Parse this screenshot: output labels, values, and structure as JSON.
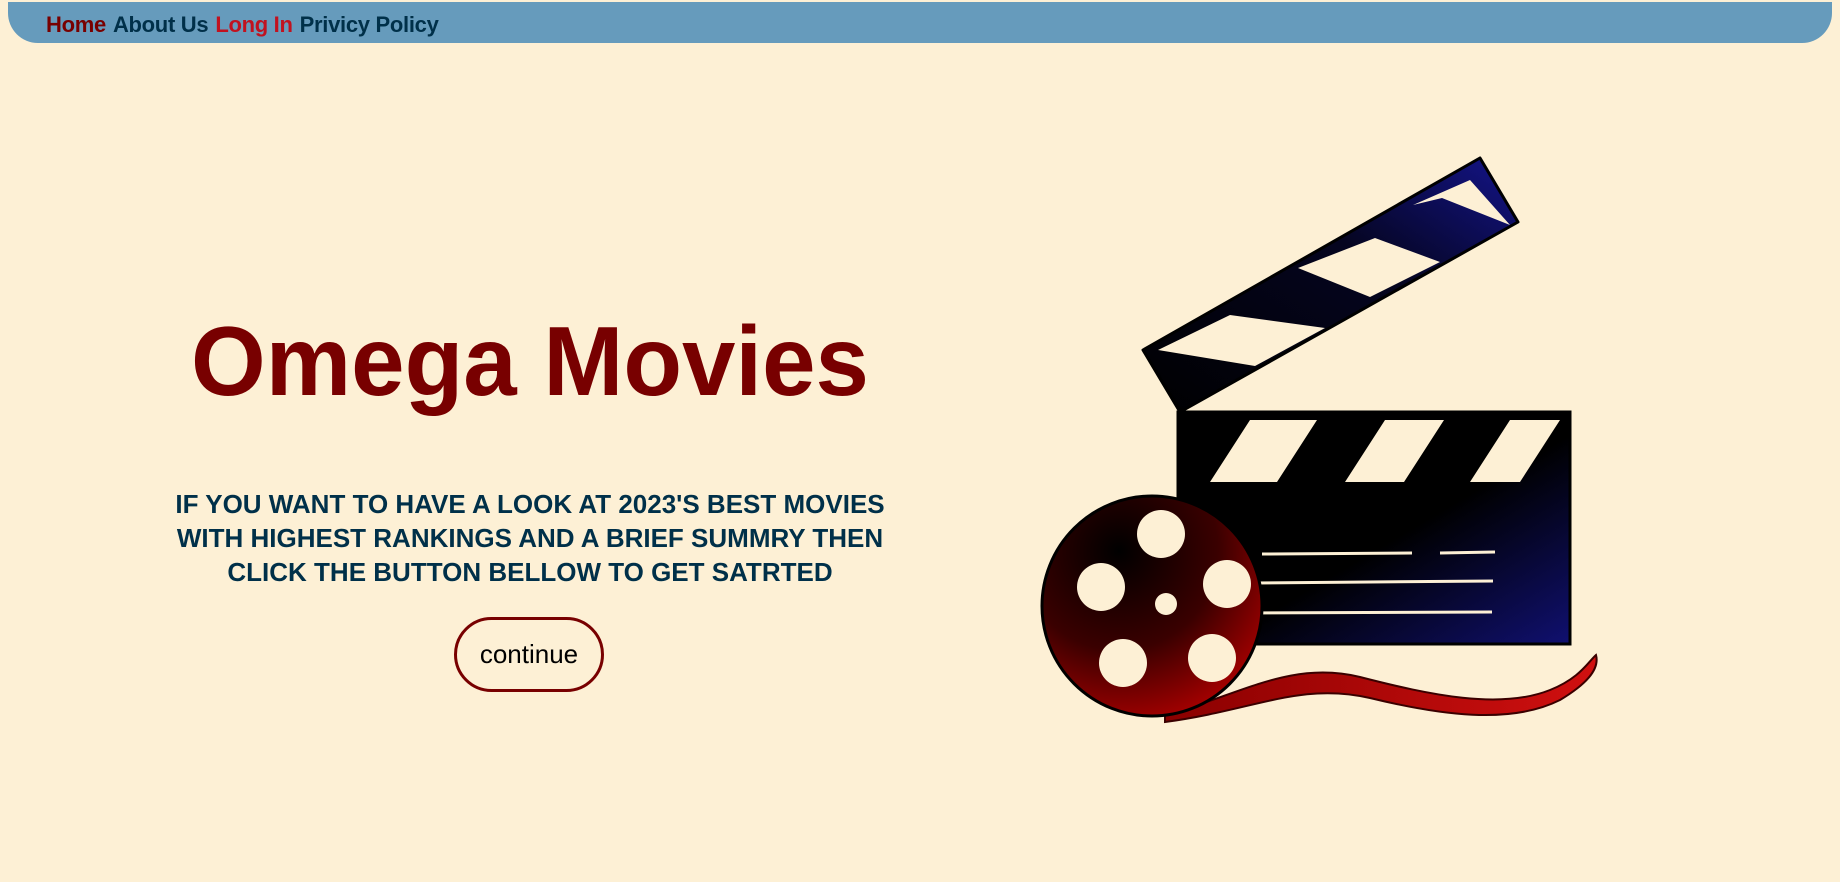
{
  "nav": {
    "items": [
      {
        "label": "Home"
      },
      {
        "label": "About Us"
      },
      {
        "label": "Long In"
      },
      {
        "label": "Privicy Policy"
      }
    ]
  },
  "hero": {
    "title": "Omega Movies",
    "tagline": "IF YOU WANT TO HAVE A LOOK AT 2023'S BEST MOVIES WITH HIGHEST RANKINGS AND A BRIEF SUMMRY THEN CLICK THE BUTTON BELLOW TO GET SATRTED",
    "button_label": "continue",
    "image_icon": "film-clapperboard-reel-icon"
  },
  "colors": {
    "background": "#fdf0d5",
    "navbar": "#669bbc",
    "title": "#780000",
    "navy": "#003049",
    "accent_red": "#c1121f"
  }
}
